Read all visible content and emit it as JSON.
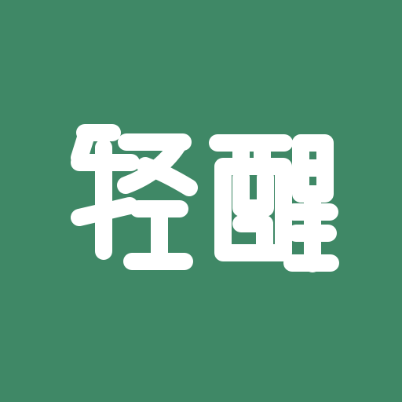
{
  "app_icon": {
    "logo_text": "轻醒",
    "background_color": "#3f8866",
    "foreground_color": "#ffffff"
  }
}
